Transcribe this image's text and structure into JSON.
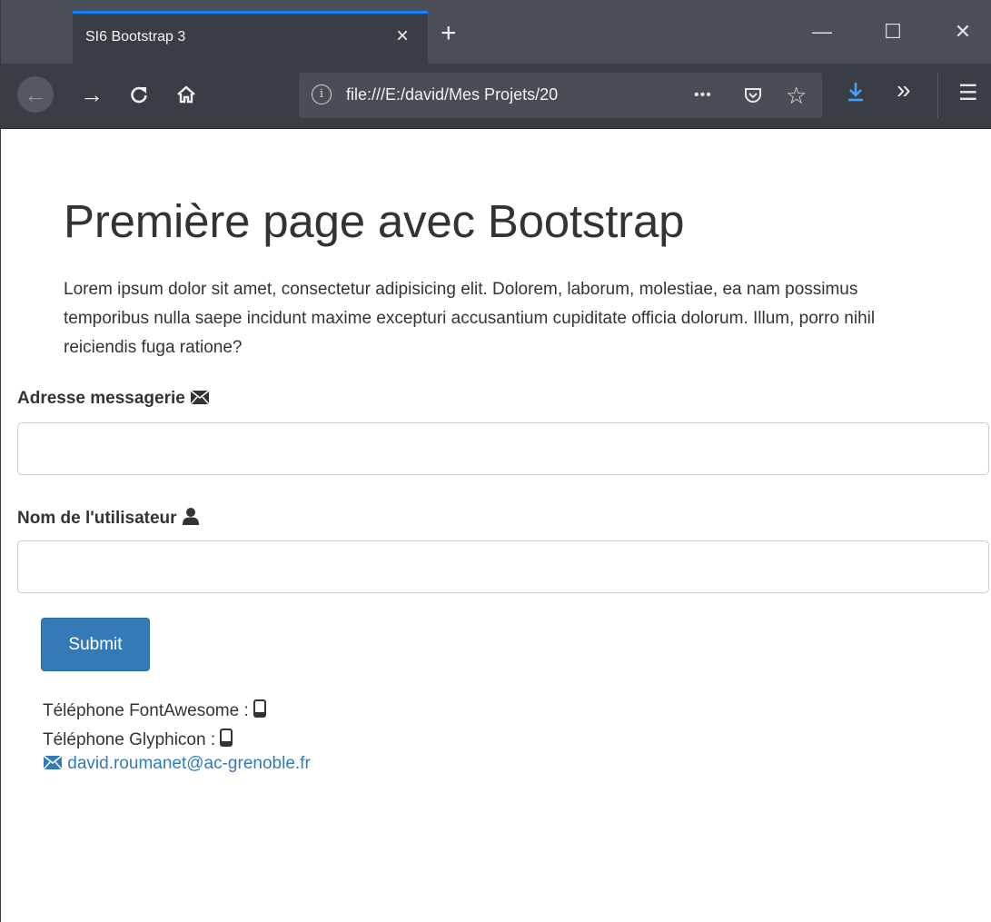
{
  "browser": {
    "tab_title": "SI6 Bootstrap 3",
    "tab_close": "×",
    "new_tab": "+",
    "window_controls": {
      "minimize": "—",
      "maximize": "☐",
      "close": "✕"
    },
    "nav": {
      "back": "←",
      "forward": "→",
      "reload": "C",
      "home": "⌂"
    },
    "url": "file:///E:/david/Mes Projets/20",
    "url_info": "i",
    "url_actions": {
      "more": "•••",
      "pocket": "pocket-icon",
      "bookmark": "☆"
    },
    "toolbar": {
      "download": "download-icon",
      "overflow": "»",
      "menu": "☰"
    },
    "colors": {
      "accent": "#0a84ff",
      "download": "#45a1ff"
    }
  },
  "page": {
    "title": "Première page avec Bootstrap",
    "lead": "Lorem ipsum dolor sit amet, consectetur adipisicing elit. Dolorem, laborum, molestiae, ea nam possimus temporibus nulla saepe incidunt maxime excepturi accusantium cupiditate officia dolorum. Illum, porro nihil reiciendis fuga ratione?",
    "form": {
      "email_label": "Adresse messagerie",
      "email_icon": "envelope-icon",
      "email_value": "",
      "username_label": "Nom de l'utilisateur",
      "username_icon": "user-icon",
      "username_value": "",
      "submit_label": "Submit"
    },
    "phone_fa_label": "Téléphone FontAwesome :",
    "phone_glyph_label": "Téléphone Glyphicon :",
    "phone_icon": "mobile-phone-icon",
    "contact_email": "david.roumanet@ac-grenoble.fr",
    "colors": {
      "primary": "#337ab7",
      "text": "#333333"
    }
  }
}
